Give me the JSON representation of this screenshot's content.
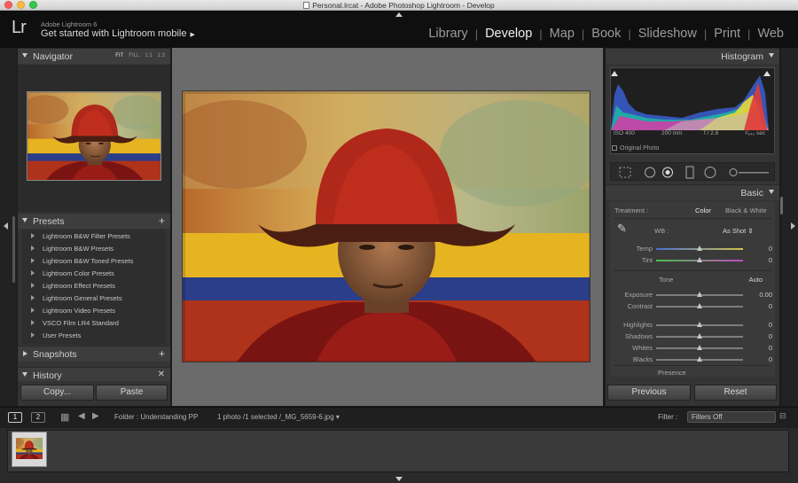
{
  "window": {
    "title": "Personal.lrcat - Adobe Photoshop Lightroom - Develop"
  },
  "identity": {
    "logo": "Lr",
    "product": "Adobe Lightroom 6",
    "mobile_label": "Get started with Lightroom mobile",
    "mobile_arrow": "▶"
  },
  "modules": [
    "Library",
    "Develop",
    "Map",
    "Book",
    "Slideshow",
    "Print",
    "Web"
  ],
  "active_module": "Develop",
  "navigator": {
    "title": "Navigator",
    "zoom": [
      "FIT",
      "FILL",
      "1:1",
      "1:3"
    ],
    "active_zoom": "FIT"
  },
  "presets": {
    "title": "Presets",
    "items": [
      "Lightroom B&W Filter Presets",
      "Lightroom B&W Presets",
      "Lightroom B&W Toned Presets",
      "Lightroom Color Presets",
      "Lightroom Effect Presets",
      "Lightroom General Presets",
      "Lightroom Video Presets",
      "VSCO Film LR4 Standard",
      "User Presets"
    ]
  },
  "snapshots": {
    "title": "Snapshots"
  },
  "history": {
    "title": "History"
  },
  "left_buttons": {
    "copy": "Copy...",
    "paste": "Paste"
  },
  "histogram": {
    "title": "Histogram",
    "iso": "ISO 400",
    "focal": "200 mm",
    "aperture": "f / 2.8",
    "shutter": "¹⁄₆₄₀ sec",
    "original_photo": "Original Photo"
  },
  "basic": {
    "title": "Basic",
    "treatment_label": "Treatment :",
    "color": "Color",
    "bw": "Black & White",
    "wb_label": "WB :",
    "wb_value": "As Shot",
    "temp_label": "Temp",
    "temp_value": "0",
    "temp_level": 0.5,
    "tint_label": "Tint",
    "tint_value": "0",
    "tint_level": 0.5,
    "tone_label": "Tone",
    "auto": "Auto",
    "sliders": [
      {
        "label": "Exposure",
        "value": "0.00",
        "level": 0.5
      },
      {
        "label": "Contrast",
        "value": "0",
        "level": 0.5
      },
      {
        "label": "Highlights",
        "value": "0",
        "level": 0.5
      },
      {
        "label": "Shadows",
        "value": "0",
        "level": 0.5
      },
      {
        "label": "Whites",
        "value": "0",
        "level": 0.5
      },
      {
        "label": "Blacks",
        "value": "0",
        "level": 0.5
      }
    ],
    "presence": "Presence"
  },
  "right_buttons": {
    "previous": "Previous",
    "reset": "Reset"
  },
  "filmbar": {
    "screen1": "1",
    "screen2": "2",
    "folder": "Folder : Understanding PP",
    "selection": "1 photo /1 selected /_MG_5659-6.jpg",
    "filter_label": "Filter :",
    "filter_value": "Filters Off"
  },
  "colors": {
    "panel": "#343434",
    "center": "#6b6b6b",
    "accent_text": "#f0f0f0"
  }
}
